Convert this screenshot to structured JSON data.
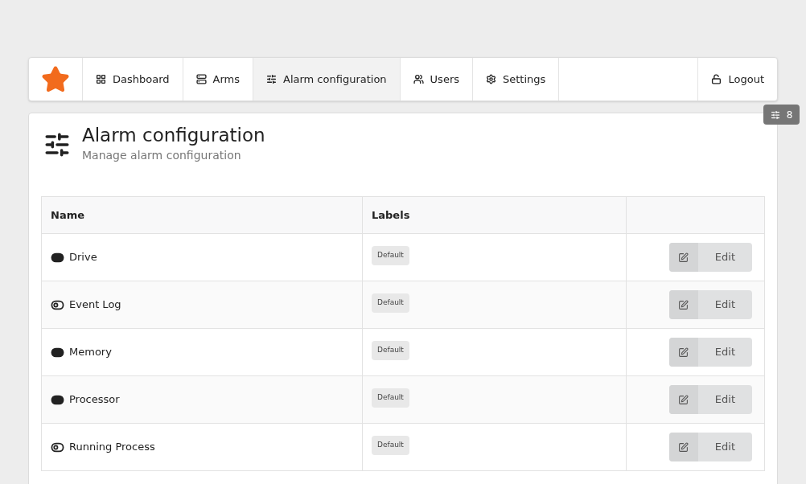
{
  "nav": {
    "items": [
      {
        "label": "Dashboard",
        "selected": false
      },
      {
        "label": "Arms",
        "selected": false
      },
      {
        "label": "Alarm configuration",
        "selected": true
      },
      {
        "label": "Users",
        "selected": false
      },
      {
        "label": "Settings",
        "selected": false
      }
    ],
    "logout": "Logout"
  },
  "filter_badge": "8",
  "header": {
    "title": "Alarm configuration",
    "subtitle": "Manage alarm configuration"
  },
  "table": {
    "columns": [
      "Name",
      "Labels"
    ],
    "rows": [
      {
        "name": "Drive",
        "on": true,
        "labels": [
          "Default"
        ],
        "action": "Edit"
      },
      {
        "name": "Event Log",
        "on": false,
        "labels": [
          "Default"
        ],
        "action": "Edit"
      },
      {
        "name": "Memory",
        "on": true,
        "labels": [
          "Default"
        ],
        "action": "Edit"
      },
      {
        "name": "Processor",
        "on": true,
        "labels": [
          "Default"
        ],
        "action": "Edit"
      },
      {
        "name": "Running Process",
        "on": false,
        "labels": [
          "Default"
        ],
        "action": "Edit"
      }
    ]
  }
}
